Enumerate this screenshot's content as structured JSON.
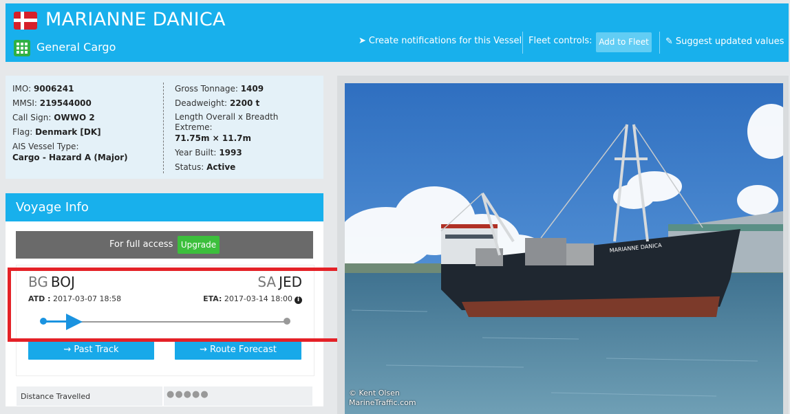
{
  "header": {
    "vessel_name": "MARIANNE DANICA",
    "vessel_type": "General Cargo",
    "flag_icon": "denmark-flag-icon",
    "type_icon": "grid-icon",
    "notifications_label": "Create notifications for this Vessel",
    "fleet_controls_label": "Fleet controls:",
    "add_to_fleet_label": "Add to Fleet",
    "suggest_label": "Suggest updated values",
    "brand_color": "#18b0ec"
  },
  "details": {
    "imo_label": "IMO:",
    "imo": "9006241",
    "mmsi_label": "MMSI:",
    "mmsi": "219544000",
    "callsign_label": "Call Sign:",
    "callsign": "OWWO 2",
    "flag_label": "Flag:",
    "flag": "Denmark [DK]",
    "ais_label": "AIS Vessel Type:",
    "ais_type": "Cargo - Hazard A (Major)",
    "gross_label": "Gross Tonnage:",
    "gross": "1409",
    "dwt_label": "Deadweight:",
    "dwt": "2200 t",
    "length_label_1": "Length Overall x Breadth",
    "length_label_2": "Extreme:",
    "length": "71.75m × 11.7m",
    "year_label": "Year Built:",
    "year": "1993",
    "status_label": "Status:",
    "status": "Active"
  },
  "voyage": {
    "title": "Voyage Info",
    "full_access_text": "For full access",
    "upgrade_label": "Upgrade",
    "departure_country": "BG",
    "departure_port": "BOJ",
    "arrival_country": "SA",
    "arrival_port": "JED",
    "atd_label": "ATD :",
    "atd": "2017-03-07 18:58",
    "eta_label": "ETA:",
    "eta": "2017-03-14 18:00",
    "info_glyph": "i",
    "past_track_label": "Past Track",
    "route_forecast_label": "Route Forecast",
    "distance_label": "Distance Travelled",
    "distance_value": "●●●●●"
  },
  "photo": {
    "credit_line1": "© Kent Olsen",
    "credit_line2": "MarineTraffic.com",
    "hull_name": "MARIANNE DANICA"
  }
}
